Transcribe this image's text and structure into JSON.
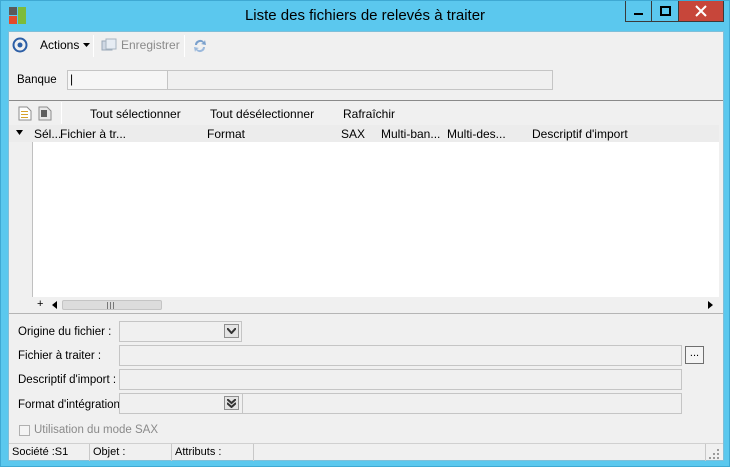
{
  "window": {
    "title": "Liste des fichiers de relevés à traiter"
  },
  "toolbar": {
    "actions_label": "Actions",
    "save_label": "Enregistrer"
  },
  "bank": {
    "label": "Banque",
    "value": "|"
  },
  "grid": {
    "toolbar": {
      "select_all": "Tout sélectionner",
      "deselect_all": "Tout désélectionner",
      "refresh": "Rafraîchir"
    },
    "columns": [
      "Sél...",
      "Fichier à tr...",
      "Format",
      "SAX",
      "Multi-ban...",
      "Multi-des...",
      "Descriptif d'import"
    ],
    "add_row_symbol": "+"
  },
  "form": {
    "origin_label": "Origine du fichier :",
    "file_label": "Fichier à traiter :",
    "browse_label": "...",
    "descriptor_label": "Descriptif d'import :",
    "integration_label": "Format d'intégration :",
    "sax_label": "Utilisation du mode SAX"
  },
  "status": {
    "company": "Société :S1",
    "object": "Objet :",
    "attributes": "Attributs :"
  },
  "colors": {
    "titlebar": "#5bc8ee",
    "close": "#c7463a",
    "client": "#f0f0f0"
  }
}
